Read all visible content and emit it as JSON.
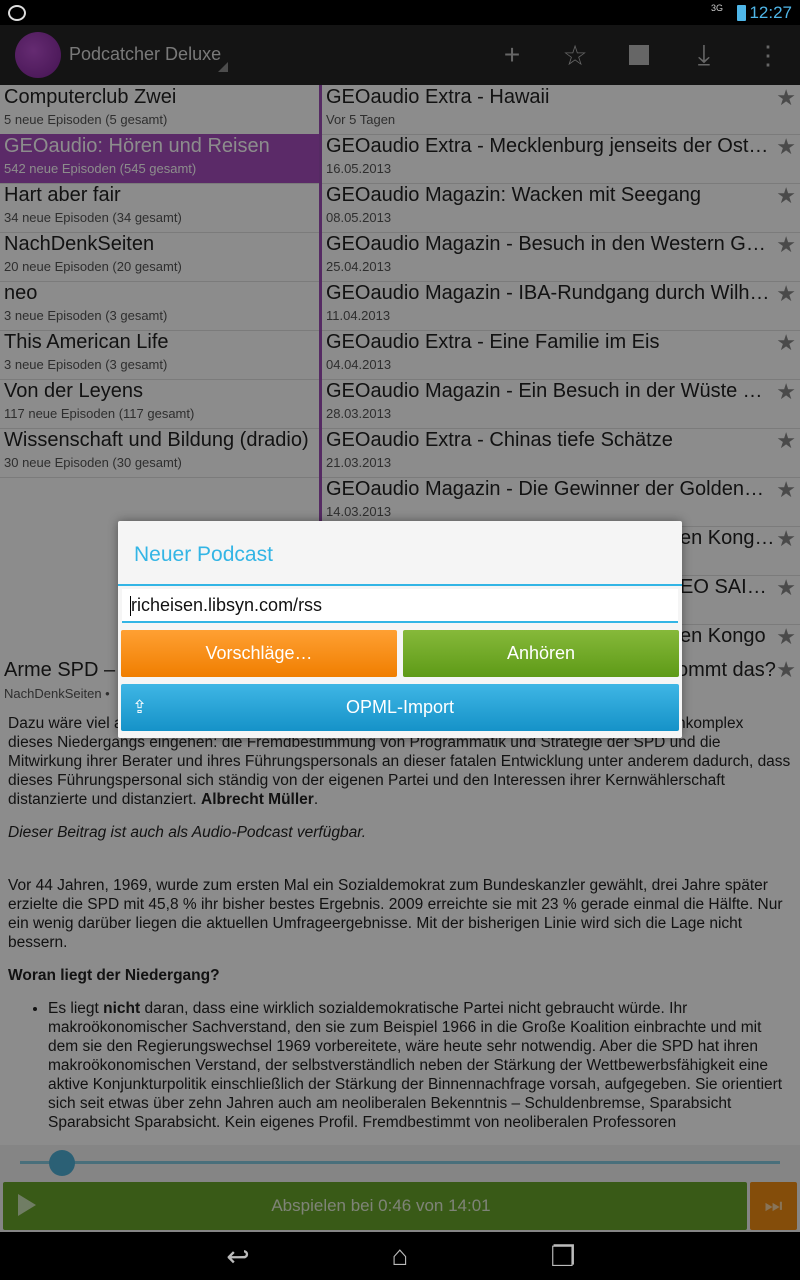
{
  "status_bar": {
    "time": "12:27",
    "network": "3G"
  },
  "app_bar": {
    "title": "Podcatcher Deluxe",
    "actions": [
      "add-icon",
      "star-icon",
      "stop-icon",
      "download-icon",
      "overflow-icon"
    ]
  },
  "podcasts": [
    {
      "name": "Computerclub Zwei",
      "info": "5 neue Episoden (5 gesamt)"
    },
    {
      "name": "GEOaudio: Hören und Reisen",
      "info": "542 neue Episoden (545 gesamt)",
      "selected": true
    },
    {
      "name": "Hart aber fair",
      "info": "34 neue Episoden (34 gesamt)"
    },
    {
      "name": "NachDenkSeiten",
      "info": "20 neue Episoden (20 gesamt)"
    },
    {
      "name": "neo",
      "info": "3 neue Episoden (3 gesamt)"
    },
    {
      "name": "This American Life",
      "info": "3 neue Episoden (3 gesamt)"
    },
    {
      "name": "Von der Leyens",
      "info": "117 neue Episoden (117 gesamt)"
    },
    {
      "name": "Wissenschaft und Bildung (dradio)",
      "info": "30 neue Episoden (30 gesamt)"
    }
  ],
  "episodes": [
    {
      "title": "GEOaudio Extra - Hawaii",
      "date": "Vor 5 Tagen"
    },
    {
      "title": "GEOaudio Extra - Mecklenburg jenseits der Ostsee",
      "date": "16.05.2013"
    },
    {
      "title": "GEOaudio Magazin: Wacken mit Seegang",
      "date": "08.05.2013"
    },
    {
      "title": "GEOaudio Magazin - Besuch in den Western Ghats",
      "date": "25.04.2013"
    },
    {
      "title": "GEOaudio Magazin - IBA-Rundgang durch Wilhelmsburg",
      "date": "11.04.2013"
    },
    {
      "title": "GEOaudio Extra - Eine Familie im Eis",
      "date": "04.04.2013"
    },
    {
      "title": "GEOaudio Magazin - Ein Besuch in der Wüste Thar",
      "date": "28.03.2013"
    },
    {
      "title": "GEOaudio Extra - Chinas tiefe Schätze",
      "date": "21.03.2013"
    },
    {
      "title": "GEOaudio Magazin - Die Gewinner der Goldenen Kamera",
      "date": "14.03.2013"
    },
    {
      "title": "en Kongo…",
      "date": ""
    },
    {
      "title": "EO SAIS…",
      "date": ""
    },
    {
      "title": "en Kongo",
      "date": ""
    }
  ],
  "detail": {
    "title_left": "Arme SPD –",
    "title_right": "ommt das?",
    "subtitle": "NachDenkSeiten •",
    "para1_start": "Dazu wäre viel a",
    "para1_mid_right": "nkomplex",
    "para1_rest": "dieses Niedergangs eingehen: die Fremdbestimmung von Programmatik und Strategie der SPD und die Mitwirkung ihrer Berater und ihres Führungspersonals an dieser fatalen Entwicklung unter anderem dadurch, dass dieses Führungspersonal sich ständig von der eigenen Partei und den Interessen ihrer Kernwählerschaft distanzierte und distanziert.",
    "author": "Albrecht Müller",
    "audio_note": "Dieser Beitrag ist auch als Audio-Podcast verfügbar.",
    "para2": "Vor 44 Jahren, 1969, wurde zum ersten Mal ein Sozialdemokrat zum Bundeskanzler gewählt, drei Jahre später erzielte die SPD mit 45,8 % ihr bisher bestes Ergebnis. 2009 erreichte sie mit 23 % gerade einmal die Hälfte. Nur ein wenig darüber liegen die aktuellen Umfrageergebnisse. Mit der bisherigen Linie wird sich die Lage nicht bessern.",
    "heading": "Woran liegt der Niedergang?",
    "bullet_pre": "Es liegt ",
    "bullet_bold": "nicht",
    "bullet_post": " daran, dass eine wirklich sozialdemokratische Partei nicht gebraucht würde. Ihr makroökonomischer Sachverstand, den sie zum Beispiel 1966 in die Große Koalition einbrachte und mit dem sie den Regierungswechsel 1969 vorbereitete, wäre heute sehr notwendig. Aber die SPD hat ihren makroökonomischen Verstand, der selbstverständlich neben der Stärkung der Wettbewerbsfähigkeit eine aktive Konjunkturpolitik einschließlich der Stärkung der Binnennachfrage vorsah, aufgegeben. Sie orientiert sich seit etwas über zehn Jahren auch am neoliberalen Bekenntnis – Schuldenbremse, Sparabsicht Sparabsicht Sparabsicht. Kein eigenes Profil. Fremdbestimmt von neoliberalen Professoren"
  },
  "player": {
    "label": "Abspielen bei 0:46 von 14:01",
    "progress": 0.055
  },
  "dialog": {
    "title": "Neuer Podcast",
    "input_value": "richeisen.libsyn.com/rss",
    "suggestions_label": "Vorschläge…",
    "listen_label": "Anhören",
    "opml_label": "OPML-Import"
  },
  "colors": {
    "accent": "#33b5e5",
    "selected": "#a64dbd",
    "orange": "#f08c13",
    "green": "#69a52a"
  }
}
